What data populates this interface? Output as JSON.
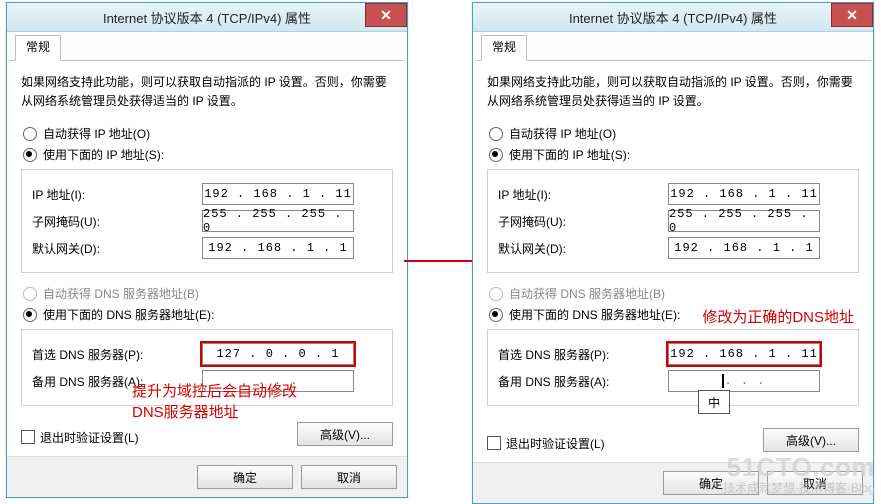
{
  "common": {
    "title": "Internet 协议版本 4 (TCP/IPv4) 属性",
    "close_glyph": "✕",
    "tab_general": "常规",
    "desc": "如果网络支持此功能，则可以获取自动指派的 IP 设置。否则，你需要从网络系统管理员处获得适当的 IP 设置。",
    "auto_ip": "自动获得 IP 地址(O)",
    "use_ip": "使用下面的 IP 地址(S):",
    "ip_label": "IP 地址(I):",
    "mask_label": "子网掩码(U):",
    "gw_label": "默认网关(D):",
    "auto_dns": "自动获得 DNS 服务器地址(B)",
    "use_dns": "使用下面的 DNS 服务器地址(E):",
    "pref_dns": "首选 DNS 服务器(P):",
    "alt_dns": "备用 DNS 服务器(A):",
    "validate": "退出时验证设置(L)",
    "adv": "高级(V)...",
    "ok": "确定",
    "cancel": "取消"
  },
  "left": {
    "ip": "192 . 168 .  1  . 11",
    "mask": "255 . 255 . 255 .  0",
    "gw": "192 . 168 .  1  .  1",
    "pref_dns": "127 .  0  .  0  .  1",
    "alt_dns": " .       .       . ",
    "annot_line1": "提升为域控后会自动修改",
    "annot_line2": "DNS服务器地址"
  },
  "right": {
    "ip": "192 . 168 .  1  . 11",
    "mask": "255 . 255 . 255 .  0",
    "gw": "192 . 168 .  1  .  1",
    "pref_dns": "192 . 168 .  1  . 11",
    "alt_dns": " .       .       . ",
    "annot_line1": "修改为正确的DNS地址",
    "ime_text": "中"
  },
  "watermark": {
    "big": "51CTO.com",
    "small": "技术成就梦想·技术博客·Blog"
  }
}
